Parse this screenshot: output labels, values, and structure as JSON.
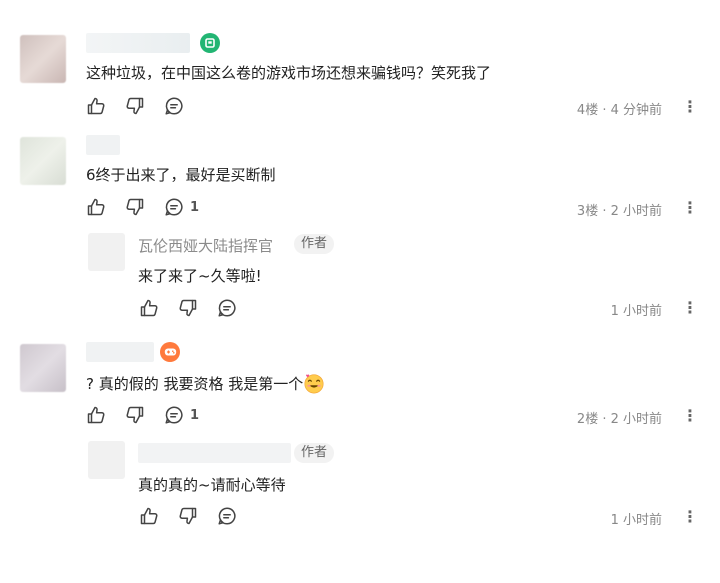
{
  "comments": [
    {
      "text": "这种垃圾，在中国这么卷的游戏市场还想来骗钱吗？笑死我了",
      "meta": "4楼 · 4 分钟前",
      "reply_count": ""
    },
    {
      "text": "6终于出来了，最好是买断制",
      "meta": "3楼 · 2 小时前",
      "reply_count": "1",
      "reply": {
        "name": "瓦伦西娅大陆指挥官",
        "author_tag": "作者",
        "text": "来了来了~久等啦!",
        "meta": "1 小时前"
      }
    },
    {
      "text": "? 真的假的 我要资格 我是第一个",
      "meta": "2楼 · 2 小时前",
      "reply_count": "1",
      "reply": {
        "name": "",
        "author_tag": "作者",
        "text": "真的真的~请耐心等待",
        "meta": "1 小时前"
      }
    }
  ],
  "icons": {
    "like": "thumbs-up-icon",
    "dislike": "thumbs-down-icon",
    "reply": "comment-icon",
    "more": "more-vertical-icon"
  },
  "colors": {
    "badge_green": "#22b573",
    "badge_orange": "#ff7a3d"
  }
}
